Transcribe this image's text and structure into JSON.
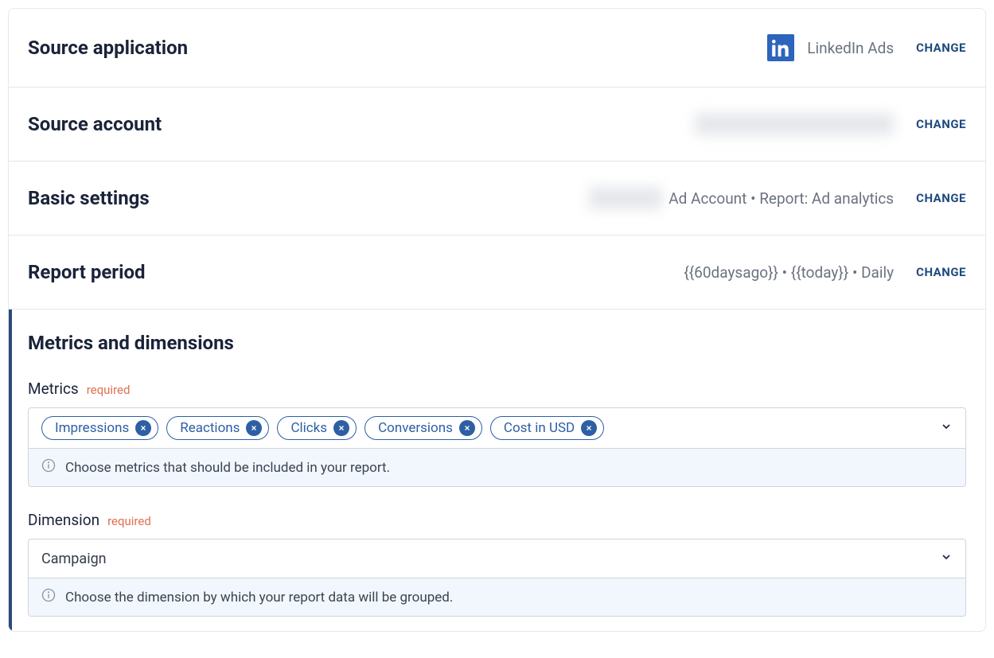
{
  "rows": {
    "sourceApp": {
      "label": "Source application",
      "value": "LinkedIn Ads",
      "change": "CHANGE"
    },
    "sourceAccount": {
      "label": "Source account",
      "change": "CHANGE"
    },
    "basicSettings": {
      "label": "Basic settings",
      "valueSuffix": "Ad Account • Report: Ad analytics",
      "change": "CHANGE"
    },
    "reportPeriod": {
      "label": "Report period",
      "value": "{{60daysago}} • {{today}} • Daily",
      "change": "CHANGE"
    }
  },
  "metricsSection": {
    "title": "Metrics and dimensions",
    "metrics": {
      "label": "Metrics",
      "required": "required",
      "chips": [
        "Impressions",
        "Reactions",
        "Clicks",
        "Conversions",
        "Cost in USD"
      ],
      "hint": "Choose metrics that should be included in your report."
    },
    "dimension": {
      "label": "Dimension",
      "required": "required",
      "value": "Campaign",
      "hint": "Choose the dimension by which your report data will be grouped."
    }
  }
}
